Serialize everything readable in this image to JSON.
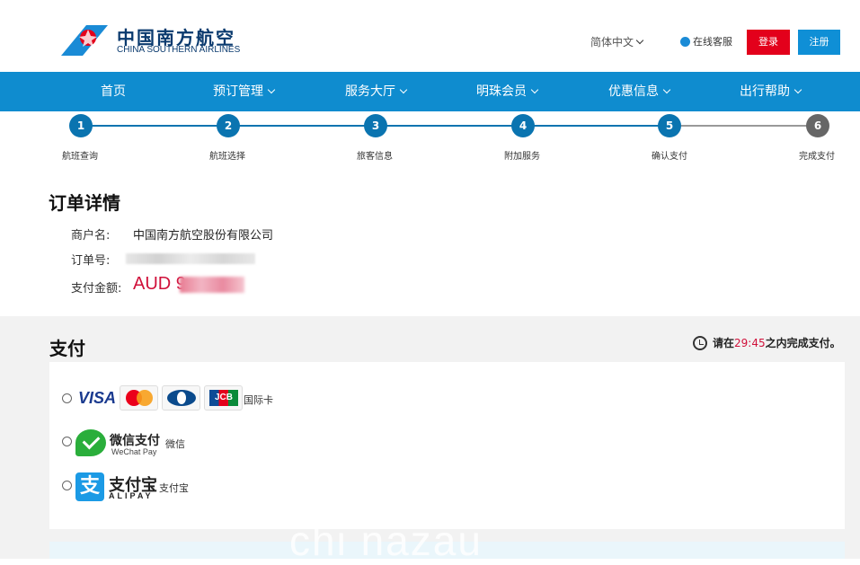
{
  "header": {
    "logo_cn": "中国南方航空",
    "logo_en": "CHINA SOUTHERN AIRLINES",
    "language": "简体中文",
    "service": "在线客服",
    "login": "登录",
    "register": "注册"
  },
  "nav": {
    "items": [
      {
        "label": "首页",
        "dropdown": false
      },
      {
        "label": "预订管理",
        "dropdown": true
      },
      {
        "label": "服务大厅",
        "dropdown": true
      },
      {
        "label": "明珠会员",
        "dropdown": true
      },
      {
        "label": "优惠信息",
        "dropdown": true
      },
      {
        "label": "出行帮助",
        "dropdown": true
      }
    ]
  },
  "steps": {
    "items": [
      {
        "num": "1",
        "label": "航班查询"
      },
      {
        "num": "2",
        "label": "航班选择"
      },
      {
        "num": "3",
        "label": "旅客信息"
      },
      {
        "num": "4",
        "label": "附加服务"
      },
      {
        "num": "5",
        "label": "确认支付"
      },
      {
        "num": "6",
        "label": "完成支付"
      }
    ],
    "current": 5
  },
  "order": {
    "title": "订单详情",
    "merchant_label": "商户名:",
    "merchant_value": "中国南方航空股份有限公司",
    "order_no_label": "订单号:",
    "amount_label": "支付金额:",
    "amount_value": "AUD 9"
  },
  "payment": {
    "title": "支付",
    "timer_prefix": "请在",
    "timer_time": "29:45",
    "timer_suffix": "之内完成支付。",
    "card_label": "国际卡",
    "card_visa": "VISA",
    "card_jcb": "JCB",
    "wechat_cn": "微信支付",
    "wechat_en": "WeChat Pay",
    "wechat_label": "微信",
    "alipay_icon": "支",
    "alipay_cn": "支付宝",
    "alipay_en": "ALIPAY",
    "alipay_label": "支付宝"
  },
  "watermark": "chi nazau",
  "colors": {
    "nav_blue": "#0f8ccf",
    "step_active": "#0a74b0",
    "step_inactive": "#666666",
    "login_red": "#e3001b",
    "register_blue": "#0f8fd6",
    "amount_red": "#d0103a"
  }
}
